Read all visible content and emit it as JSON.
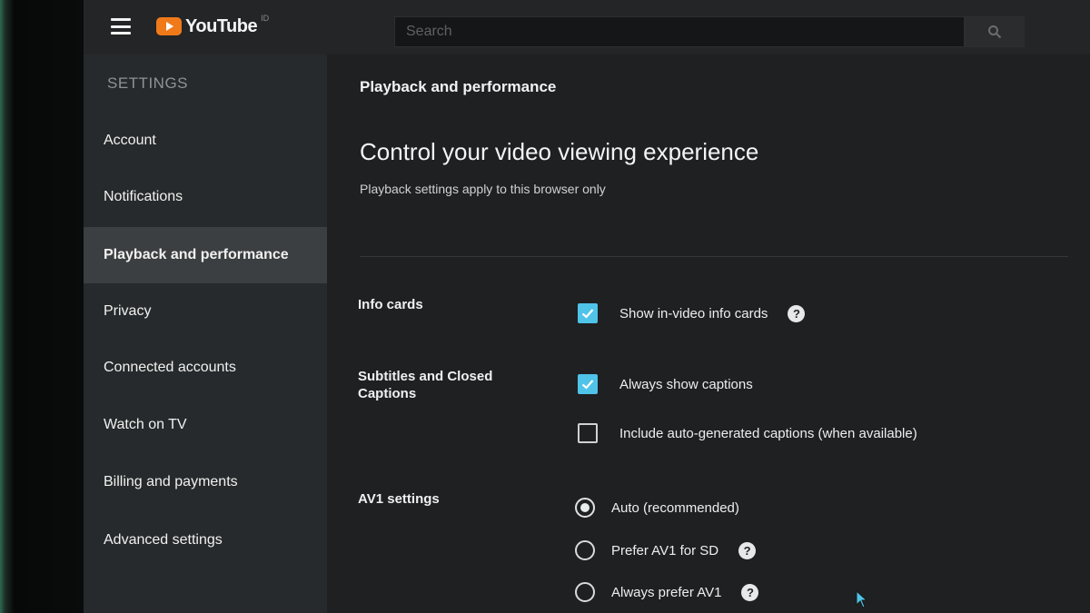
{
  "topbar": {
    "logo_text": "YouTube",
    "logo_region": "ID",
    "search_placeholder": "Search"
  },
  "sidebar": {
    "heading": "SETTINGS",
    "items": [
      {
        "label": "Account",
        "active": false
      },
      {
        "label": "Notifications",
        "active": false
      },
      {
        "label": "Playback and performance",
        "active": true
      },
      {
        "label": "Privacy",
        "active": false
      },
      {
        "label": "Connected accounts",
        "active": false
      },
      {
        "label": "Watch on TV",
        "active": false
      },
      {
        "label": "Billing and payments",
        "active": false
      },
      {
        "label": "Advanced settings",
        "active": false
      }
    ]
  },
  "main": {
    "section_title": "Playback and performance",
    "headline": "Control your video viewing experience",
    "subline": "Playback settings apply to this browser only",
    "info_cards": {
      "label": "Info cards",
      "option": {
        "label": "Show in-video info cards",
        "checked": true
      }
    },
    "captions": {
      "label": "Subtitles and Closed Captions",
      "options": [
        {
          "label": "Always show captions",
          "checked": true
        },
        {
          "label": "Include auto-generated captions (when available)",
          "checked": false
        }
      ]
    },
    "av1": {
      "label": "AV1 settings",
      "options": [
        {
          "label": "Auto (recommended)",
          "selected": true
        },
        {
          "label": "Prefer AV1 for SD",
          "selected": false
        },
        {
          "label": "Always prefer AV1",
          "selected": false
        }
      ]
    },
    "help_symbol": "?"
  },
  "colors": {
    "accent_checkbox": "#4fc3e8",
    "logo": "#f07a1a"
  }
}
